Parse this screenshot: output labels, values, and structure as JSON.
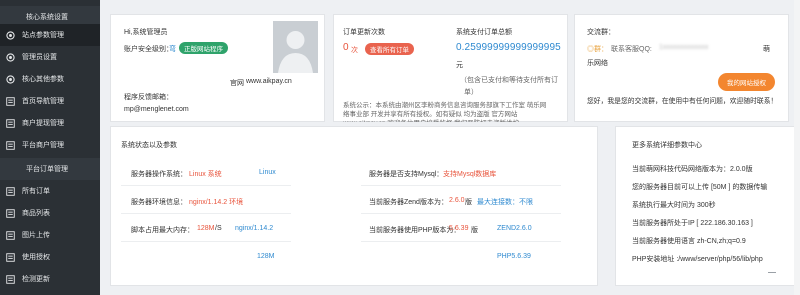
{
  "sidebar": {
    "items": [
      {
        "label": "核心系统设置",
        "icon": "none",
        "group": true
      },
      {
        "label": "站点参数管理",
        "icon": "circle-icon",
        "active": true
      },
      {
        "label": "管理员设置",
        "icon": "circle-icon"
      },
      {
        "label": "核心其他参数",
        "icon": "circle-icon"
      },
      {
        "label": "首页导航管理",
        "icon": "list-icon"
      },
      {
        "label": "商户提现管理",
        "icon": "list-icon"
      },
      {
        "label": "平台商户管理",
        "icon": "list-icon"
      },
      {
        "label": "平台订单管理",
        "icon": "none",
        "group": true
      },
      {
        "label": "所有订单",
        "icon": "list-icon"
      },
      {
        "label": "商品列表",
        "icon": "list-icon"
      },
      {
        "label": "图片上传",
        "icon": "list-icon"
      },
      {
        "label": "使用授权",
        "icon": "list-icon"
      },
      {
        "label": "检测更新",
        "icon": "list-icon"
      }
    ]
  },
  "admin": {
    "greeting": "Hi,系统管理员",
    "security_label": "账户安全级别：",
    "security_level": "弯",
    "genuine_badge": "正版网站程序",
    "site_label": "官网",
    "site_url": "www.aikpay.cn",
    "feedback_label": "程序反馈邮箱：",
    "feedback_email": "mp@menglenet.com"
  },
  "orders": {
    "today_label": "订单更新次数",
    "today_count": "0",
    "today_unit": "次",
    "view_all": "查看所有订单",
    "total_label": "系统支付订单总额",
    "total_value": "0.25999999999999995",
    "total_unit": "元",
    "total_note_1": "（包含已支付和等待支付所有订",
    "total_note_2": "单）",
    "notice_1": "系统公示：本系统由潮州区李粉商务信息咨询服务部旗下工作室 萌乐网",
    "notice_2": "络事业部 开发并享有所有授权。如有疑似 均为盗版 官方网站",
    "notice_3": "www.aikpay.cn  欢迎各位用户接受监督 我们严防打击盗版维护"
  },
  "contact": {
    "title": "交流群：",
    "qq_prefix": "◎群：",
    "qq_label": "联系客服QQ:",
    "qq_blur": "1xxxxxxxxxxxxx",
    "brand_1": "萌",
    "brand_2": "乐网络",
    "auth_button": "我的网站授权",
    "welcome": "您好，我是您的交流群，在使用中有任何问题，欢迎随时联系！"
  },
  "status": {
    "title": "系统状态以及参数",
    "os_label": "服务器操作系统：",
    "os_value": "Linux 系统",
    "os_short": "Linux",
    "mysql_label": "服务器是否支持Mysql：",
    "mysql_value": "支持Mysql数据库",
    "env_label": "服务器环境信息：",
    "env_value": "nginx/1.14.2 环境",
    "zend_label": "当前服务器Zend版本为：",
    "zend_value": "2.6.0",
    "zend_unit": "版",
    "zend_link": "最大连接数：不限",
    "mem_label": "脚本占用最大内存：",
    "mem_value": "128M",
    "mem_unit": "/S",
    "mem_short": "nginx/1.14.2",
    "php_label": "当前服务器使用PHP版本为：",
    "php_value": "5.6.39",
    "php_unit": "版",
    "zend_short": "ZEND2.6.0",
    "mem_foot": "128M",
    "php_foot": "PHP5.6.39"
  },
  "more": {
    "title": "更多系统详细参数中心",
    "items": [
      "当前萌网科技代码网络版本为：2.0.0版",
      "您的服务器目前可以上传 [50M ] 的数据传输",
      "系统执行最大时间为 300秒",
      "当前服务器所处于IP [ 222.186.30.163 ]",
      "当前服务器使用语言 zh-CN,zh;q=0.9",
      "PHP安装地址 :/www/server/php/56/lib/php"
    ]
  }
}
